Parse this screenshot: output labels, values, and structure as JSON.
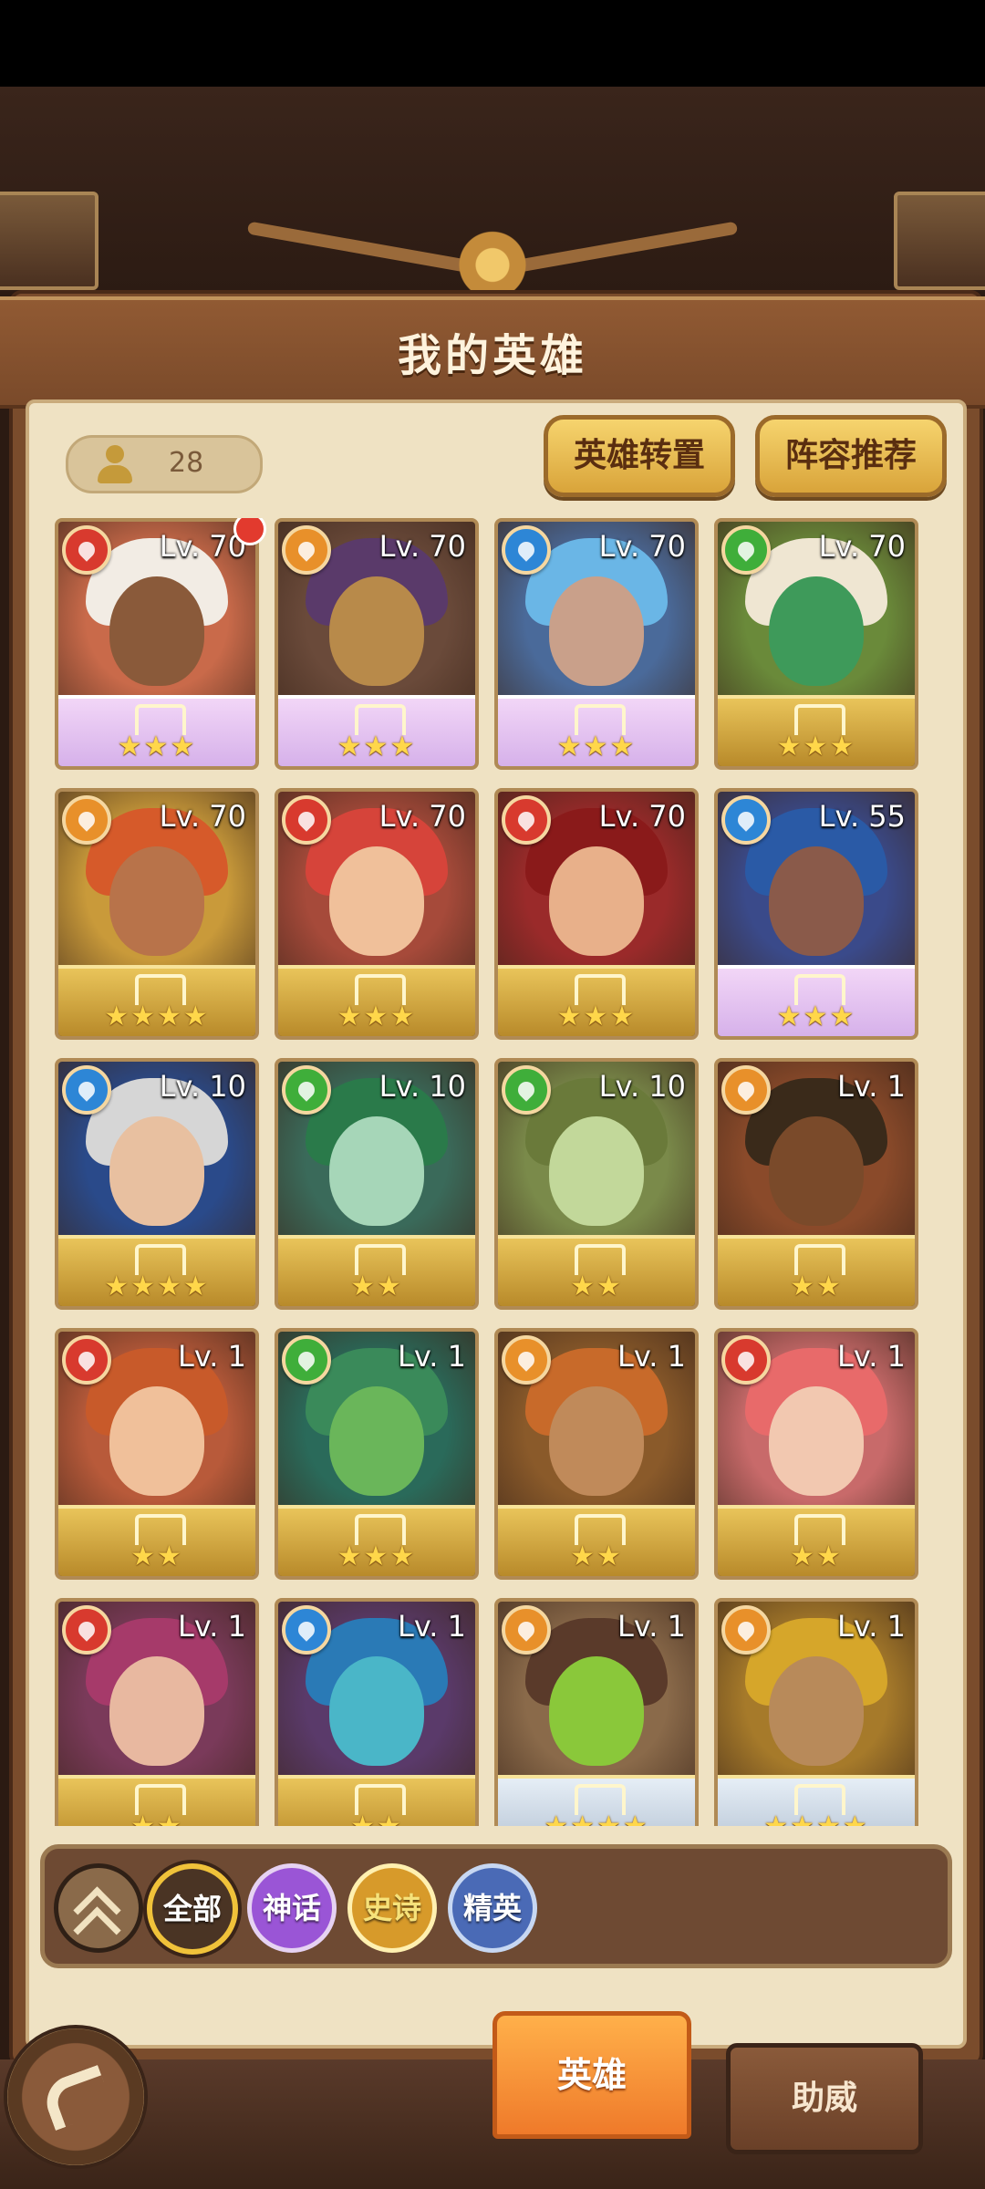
{
  "header": {
    "title": "我的英雄"
  },
  "hero_count": "28",
  "buttons": {
    "transfer": "英雄转置",
    "recommend": "阵容推荐"
  },
  "heroes": [
    {
      "level": "Lv. 70",
      "element": "fire",
      "stars": "★★★",
      "tier": "mythic",
      "skin": "#8a5a3a",
      "hair": "#f2ece4",
      "bg": "#c96a4a",
      "notify": true
    },
    {
      "level": "Lv. 70",
      "element": "earth",
      "stars": "★★★",
      "tier": "mythic",
      "skin": "#b88a4a",
      "hair": "#5a3a6a",
      "bg": "#6a4a3a"
    },
    {
      "level": "Lv. 70",
      "element": "water",
      "stars": "★★★",
      "tier": "mythic",
      "skin": "#c9a08a",
      "hair": "#6ab6e6",
      "bg": "#4a6a9a"
    },
    {
      "level": "Lv. 70",
      "element": "wind",
      "stars": "★★★",
      "tier": "gold",
      "skin": "#3e9a5a",
      "hair": "#efe6d2",
      "bg": "#6a8a3a"
    },
    {
      "level": "Lv. 70",
      "element": "earth",
      "stars": "★★★★",
      "tier": "gold",
      "skin": "#b8734a",
      "hair": "#d65a2a",
      "bg": "#c99a3a"
    },
    {
      "level": "Lv. 70",
      "element": "fire",
      "stars": "★★★",
      "tier": "gold",
      "skin": "#f0c09a",
      "hair": "#d6443a",
      "bg": "#a64a3a"
    },
    {
      "level": "Lv. 70",
      "element": "fire",
      "stars": "★★★",
      "tier": "gold",
      "skin": "#e8b08a",
      "hair": "#8a1a1a",
      "bg": "#9a2a2a"
    },
    {
      "level": "Lv. 55",
      "element": "water",
      "stars": "★★★",
      "tier": "mythic",
      "skin": "#8a5a4a",
      "hair": "#2a5aa6",
      "bg": "#3a4a8a"
    },
    {
      "level": "Lv. 10",
      "element": "water",
      "stars": "★★★★",
      "tier": "gold",
      "skin": "#e8c0a0",
      "hair": "#d6d6d6",
      "bg": "#2a4a8a"
    },
    {
      "level": "Lv. 10",
      "element": "wind",
      "stars": "★★",
      "tier": "gold",
      "skin": "#a6d6b8",
      "hair": "#2a7a4a",
      "bg": "#3a6a5a"
    },
    {
      "level": "Lv. 10",
      "element": "wind",
      "stars": "★★",
      "tier": "gold",
      "skin": "#c2d89a",
      "hair": "#6a7a3a",
      "bg": "#7a8a4a"
    },
    {
      "level": "Lv. 1",
      "element": "earth",
      "stars": "★★",
      "tier": "gold",
      "skin": "#7a4a2a",
      "hair": "#3a2a1a",
      "bg": "#8a4a2a"
    },
    {
      "level": "Lv. 1",
      "element": "fire",
      "stars": "★★",
      "tier": "gold",
      "skin": "#f0c09a",
      "hair": "#c85a2a",
      "bg": "#b85a3a"
    },
    {
      "level": "Lv. 1",
      "element": "wind",
      "stars": "★★★",
      "tier": "gold",
      "skin": "#6ab65a",
      "hair": "#3a8a5a",
      "bg": "#2a6a5a"
    },
    {
      "level": "Lv. 1",
      "element": "earth",
      "stars": "★★",
      "tier": "gold",
      "skin": "#c08a5a",
      "hair": "#c86a2a",
      "bg": "#8a5a2a"
    },
    {
      "level": "Lv. 1",
      "element": "fire",
      "stars": "★★",
      "tier": "gold",
      "skin": "#f2c8b0",
      "hair": "#e86a6a",
      "bg": "#c86a6a"
    },
    {
      "level": "Lv. 1",
      "element": "fire",
      "stars": "★★",
      "tier": "gold",
      "skin": "#e8b8a0",
      "hair": "#a63a6a",
      "bg": "#7a3a5a"
    },
    {
      "level": "Lv. 1",
      "element": "water",
      "stars": "★★",
      "tier": "gold",
      "skin": "#4ab6c8",
      "hair": "#2a7ab6",
      "bg": "#5a3a6a"
    },
    {
      "level": "Lv. 1",
      "element": "earth",
      "stars": "★★★★",
      "tier": "silver",
      "skin": "#8ac83a",
      "hair": "#5a3a2a",
      "bg": "#8a6a4a"
    },
    {
      "level": "Lv. 1",
      "element": "earth",
      "stars": "★★★★",
      "tier": "silver",
      "skin": "#b88a5a",
      "hair": "#d6a62a",
      "bg": "#a67a2a"
    }
  ],
  "filters": {
    "all": "全部",
    "mythic": "神话",
    "epic": "史诗",
    "elite": "精英"
  },
  "tabs": {
    "hero": "英雄",
    "support": "助威"
  }
}
